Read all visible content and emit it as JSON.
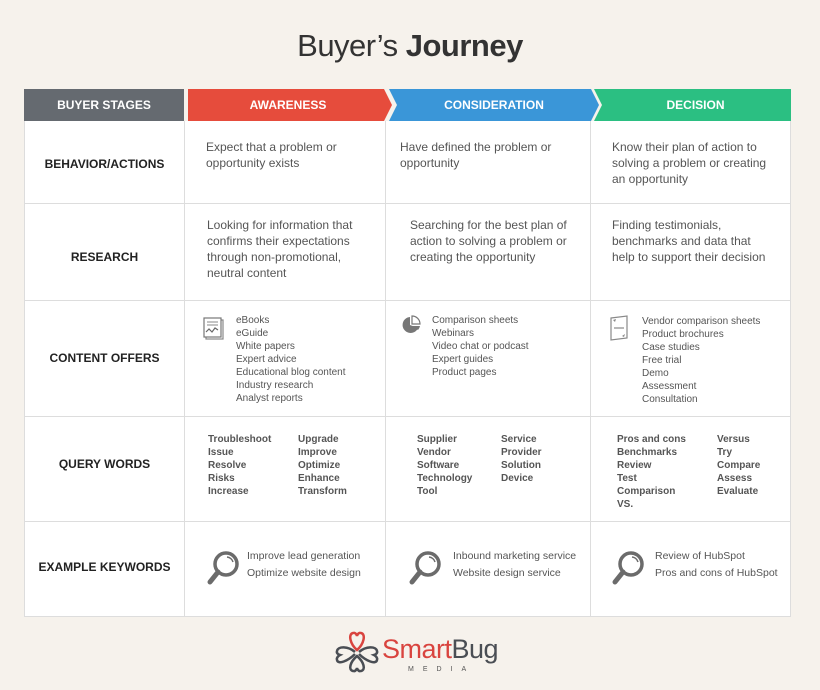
{
  "title": {
    "regular": "Buyer’s",
    "bold": "Journey"
  },
  "header": {
    "stages_label": "BUYER STAGES",
    "stages": [
      {
        "label": "AWARENESS",
        "color": "#e64c3c"
      },
      {
        "label": "CONSIDERATION",
        "color": "#3a96d8"
      },
      {
        "label": "DECISION",
        "color": "#2bbf82"
      }
    ],
    "stages_label_color": "#656a70"
  },
  "rows": {
    "behavior": {
      "label": "BEHAVIOR/ACTIONS",
      "awareness": [
        "Expect that a problem or",
        "opportunity exists"
      ],
      "consideration": [
        "Have defined the problem or",
        "opportunity"
      ],
      "decision": [
        "Know their plan of action to",
        "solving a problem or creating",
        "an opportunity"
      ]
    },
    "research": {
      "label": "RESEARCH",
      "awareness": [
        "Looking for information that",
        "confirms their expectations",
        "through non-promotional,",
        "neutral content"
      ],
      "consideration": [
        "Searching for the best plan of",
        "action to solving a problem or",
        "creating the opportunity"
      ],
      "decision": [
        "Finding testimonials,",
        "benchmarks and data that",
        "help to support their decision"
      ]
    },
    "content_offers": {
      "label": "CONTENT OFFERS",
      "awareness": {
        "icon": "document-chart-icon",
        "items": [
          "eBooks",
          "eGuide",
          "White papers",
          "Expert advice",
          "Educational blog content",
          "Industry research",
          "Analyst reports"
        ]
      },
      "consideration": {
        "icon": "pie-chart-icon",
        "items": [
          "Comparison sheets",
          "Webinars",
          "Video chat or podcast",
          "Expert guides",
          "Product pages"
        ]
      },
      "decision": {
        "icon": "brochure-icon",
        "items": [
          "Vendor comparison sheets",
          "Product brochures",
          "Case studies",
          "Free trial",
          "Demo",
          "Assessment",
          "Consultation"
        ]
      }
    },
    "query_words": {
      "label": "QUERY WORDS",
      "awareness": {
        "col1": [
          "Troubleshoot",
          "Issue",
          "Resolve",
          "Risks",
          "Increase"
        ],
        "col2": [
          "Upgrade",
          "Improve",
          "Optimize",
          "Enhance",
          "Transform"
        ]
      },
      "consideration": {
        "col1": [
          "Supplier",
          "Vendor",
          "Software",
          "Technology",
          "Tool"
        ],
        "col2": [
          "Service",
          "Provider",
          "Solution",
          "Device"
        ]
      },
      "decision": {
        "col1": [
          "Pros and cons",
          "Benchmarks",
          "Review",
          "Test",
          "Comparison",
          "VS."
        ],
        "col2": [
          "Versus",
          "Try",
          "Compare",
          "Assess",
          "Evaluate"
        ]
      }
    },
    "example_keywords": {
      "label": "EXAMPLE KEYWORDS",
      "icon": "magnifier-icon",
      "awareness": [
        "Improve lead generation",
        "Optimize website design"
      ],
      "consideration": [
        "Inbound marketing service",
        "Website design service"
      ],
      "decision": [
        "Review of HubSpot",
        "Pros and cons of HubSpot"
      ]
    }
  },
  "logo": {
    "smart": "Smart",
    "bug": "Bug",
    "media": "MEDIA"
  }
}
